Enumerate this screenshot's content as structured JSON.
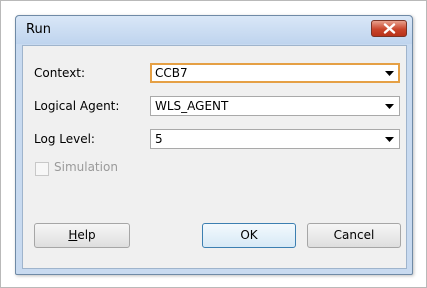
{
  "dialog": {
    "title": "Run",
    "close_label": "close"
  },
  "form": {
    "context": {
      "label": "Context:",
      "value": "CCB7"
    },
    "logical_agent": {
      "label": "Logical Agent:",
      "value": "WLS_AGENT"
    },
    "log_level": {
      "label": "Log Level:",
      "value": "5"
    },
    "simulation": {
      "label": "Simulation",
      "checked": false,
      "enabled": false
    }
  },
  "buttons": {
    "help_mnemonic": "H",
    "help_rest": "elp",
    "ok": "OK",
    "cancel": "Cancel"
  },
  "colors": {
    "focus_border": "#e5a045",
    "close_button": "#c9452b",
    "default_button_border": "#3c7fb1",
    "title_bar": "#c8daf0"
  },
  "icons": {
    "close": "close-x-icon",
    "dropdown": "chevron-down-icon",
    "checkbox": "checkbox-unchecked-icon"
  }
}
